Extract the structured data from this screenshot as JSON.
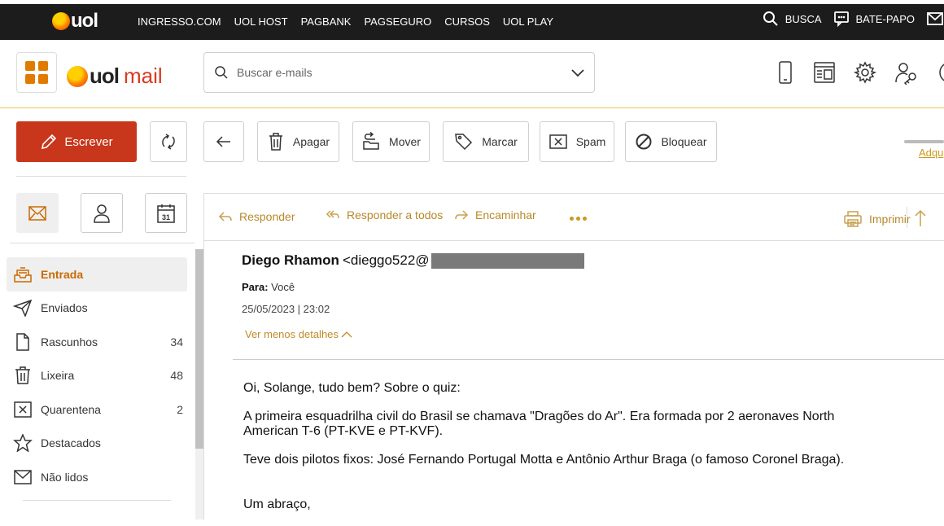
{
  "topbar": {
    "logo": "uol",
    "nav": [
      "INGRESSO.COM",
      "UOL HOST",
      "PAGBANK",
      "PAGSEGURO",
      "CURSOS",
      "UOL PLAY"
    ],
    "search_label": "BUSCA",
    "chat_label": "BATE-PAPO"
  },
  "header": {
    "logo_uol": "uol",
    "logo_mail": "mail",
    "search_placeholder": "Buscar e-mails"
  },
  "toolbar": {
    "write_label": "Escrever",
    "delete_label": "Apagar",
    "move_label": "Mover",
    "mark_label": "Marcar",
    "spam_label": "Spam",
    "block_label": "Bloquear",
    "acquire_label": "Adqu"
  },
  "folders": [
    {
      "label": "Entrada",
      "count": ""
    },
    {
      "label": "Enviados",
      "count": ""
    },
    {
      "label": "Rascunhos",
      "count": "34"
    },
    {
      "label": "Lixeira",
      "count": "48"
    },
    {
      "label": "Quarentena",
      "count": "2"
    },
    {
      "label": "Destacados",
      "count": ""
    },
    {
      "label": "Não lidos",
      "count": ""
    }
  ],
  "message_actions": {
    "reply": "Responder",
    "reply_all": "Responder a todos",
    "forward": "Encaminhar",
    "print": "Imprimir"
  },
  "message": {
    "sender_name": "Diego Rhamon",
    "sender_email_prefix": "<dieggo522@",
    "to_label": "Para:",
    "to_value": "Você",
    "date": "25/05/2023 | 23:02",
    "details_toggle": "Ver menos detalhes",
    "body": [
      "Oi, Solange, tudo bem? Sobre o quiz:",
      "A primeira esquadrilha civil do Brasil se chamava \"Dragões do Ar\". Era formada por 2 aeronaves North American T-6 (PT-KVE e PT-KVF).",
      "Teve dois pilotos fixos: José Fernando Portugal Motta e Antônio Arthur Braga (o famoso Coronel Braga)."
    ],
    "signoff": "Um abraço,"
  },
  "colors": {
    "brand_red": "#c8361b",
    "accent_gold": "#c99a1e",
    "active_orange": "#c96a00"
  }
}
